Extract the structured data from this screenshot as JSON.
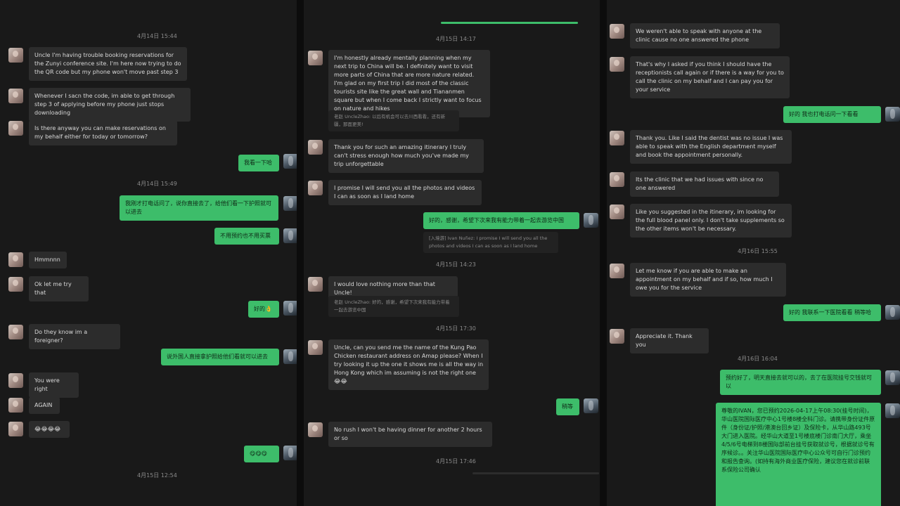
{
  "col1": {
    "timestamps": [
      "4月14日 15:44",
      "4月14日 15:49",
      "4月15日 12:54"
    ],
    "messages": [
      "Uncle I'm having trouble booking reservations for the Zunyi conference site. I'm here now trying to do the QR code but my phone won't move past step 3",
      "Whenever I sacn the code, im able to get through step 3 of applying before my phone just stops downloading",
      "Is there anyway you can make reservations on my behalf either for today or tomorrow?",
      "我看一下哈",
      "我刚才打电话问了，说你直接去了，给他们看一下护照就可以进去",
      "不用预约也不用买票",
      "Hmmnnn",
      "Ok let me try that",
      "好的👌",
      "Do they know im a foreigner?",
      "说外国人直接拿护照给他们看就可以进去",
      "You were right",
      "AGAIN",
      "😂😂😂😂",
      "😋😋😋"
    ]
  },
  "col2": {
    "timestamps": [
      "4月15日 14:17",
      "4月15日 14:23",
      "4月15日 17:30",
      "4月15日 17:46"
    ],
    "messages": [
      "I'm honestly already mentally planning when my next trip to China will be. I definitely want to visit more parts of China that are more nature related. I'm glad on my first trip I did most of the classic tourists site like the great wall and Tiananmen square but when I come back I strictly want to focus on nature and hikes",
      "老赵 UncleZhao: 以后有机会可以去川西看看，还有新疆，那面更美!",
      "Thank you for such an amazing itinerary I truly can't stress enough how much you've made my trip unforgettable",
      "I promise I will send you all the photos and videos I can as soon as I land home",
      "好的，感谢，希望下次来我有能力带着一起去游览中国",
      "[入境游] Ivan Nuñez: I promise I will send you all the photos and videos I can as soon as I land home",
      "I would love nothing more than that Uncle!",
      "老赵 UncleZhao: 好的，感谢，希望下次来我有能力带着一起去游览中国",
      "Uncle, can you send me the name of the Kung Pao Chicken restaurant address on Amap please? When I try looking it up the one it shows me is all the way in Hong Kong which im assuming is not the right one 😂😂",
      "稍等",
      "No rush I won't be having dinner for another 2 hours or so"
    ]
  },
  "col3": {
    "timestamps": [
      "4月16日 15:55",
      "4月16日 16:04"
    ],
    "messages": [
      "We weren't able to speak with anyone at the clinic cause no one answered the phone",
      "That's why I asked if you think I should have the receptionists call again or if there is a way for you to call the clinic on my behalf and I can pay you for your service",
      "好的 我也打电话问一下看看",
      "Thank you. Like I said the dentist was no issue I was able to speak with the English department myself and book the appointment personally.",
      "Its the clinic that we had issues with since no one answered",
      "Like you suggested in the itinerary, im looking for the full blood panel only. I don't take supplements so the other items won't be necessary.",
      "Let me know if you are able to make an appointment on my behalf and if so, how much I owe you for the service",
      "好的 我联系一下医院看看 稍等哈",
      "Appreciate it. Thank you",
      "预约好了，明天直接去就可以的，去了在医院挂号交钱就可以",
      "尊敬的IVAN，您已预约2026-04-17上午08:30(挂号时间)，华山医院国际医疗中心1号楼8楼全科门诊。请携带身份证件原件（身份证/护照/港澳台回乡证）及保险卡，从华山路493号大门进入医院。经华山大道至1号楼底楼门诊南门大厅，乘坐4/5/6号电梯到8楼国际部前台挂号获取就诊号，根据就诊号有序候诊。。关注华山医院国际医疗中心公众号可自行门诊预约和报告查询。(如持有海外商业医疗保险，建议您在就诊前联系保险公司确认"
    ]
  },
  "colors": {
    "bubble_left": "#2c2c2c",
    "bubble_right": "#3dbd6a",
    "background": "#191919"
  }
}
